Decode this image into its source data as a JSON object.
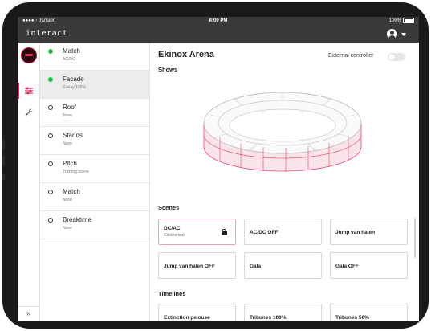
{
  "status_bar": {
    "carrier": "●●●●○ InVision",
    "time": "8:00 PM",
    "battery": "100%"
  },
  "app": {
    "brand": "interact"
  },
  "rail": {
    "expand_glyph": "»"
  },
  "scene_list": [
    {
      "name": "Match",
      "sub": "AC/DC",
      "state": "on"
    },
    {
      "name": "Facade",
      "sub": "Ganay 100%",
      "state": "on",
      "active": true
    },
    {
      "name": "Roof",
      "sub": "None",
      "state": "off"
    },
    {
      "name": "Stands",
      "sub": "None",
      "state": "off"
    },
    {
      "name": "Pitch",
      "sub": "Training scene",
      "state": "off"
    },
    {
      "name": "Match",
      "sub": "None",
      "state": "off"
    },
    {
      "name": "Breaktime",
      "sub": "None",
      "state": "off"
    }
  ],
  "main": {
    "venue": "Ekinox Arena",
    "external_controller_label": "External controller",
    "external_controller_on": false,
    "shows_label": "Shows",
    "scenes_label": "Scenes",
    "timelines_label": "Timelines",
    "scenes": [
      {
        "title": "DC/AC",
        "sub": "Click to lock",
        "selected": true,
        "locked": true
      },
      {
        "title": "AC/DC OFF"
      },
      {
        "title": "Jump van halen"
      },
      {
        "title": "Jump van halen OFF"
      },
      {
        "title": "Gala"
      },
      {
        "title": "Gala OFF"
      }
    ],
    "timelines": [
      {
        "title": "Extinction pelouse"
      },
      {
        "title": "Tribunes 100%"
      },
      {
        "title": "Tribunes 50%"
      }
    ]
  },
  "colors": {
    "accent": "#e52a5a",
    "active_dot": "#27c04a",
    "topbar": "#3a3a3a"
  },
  "icons": {
    "rail": [
      "sliders-icon",
      "wrench-icon"
    ]
  }
}
